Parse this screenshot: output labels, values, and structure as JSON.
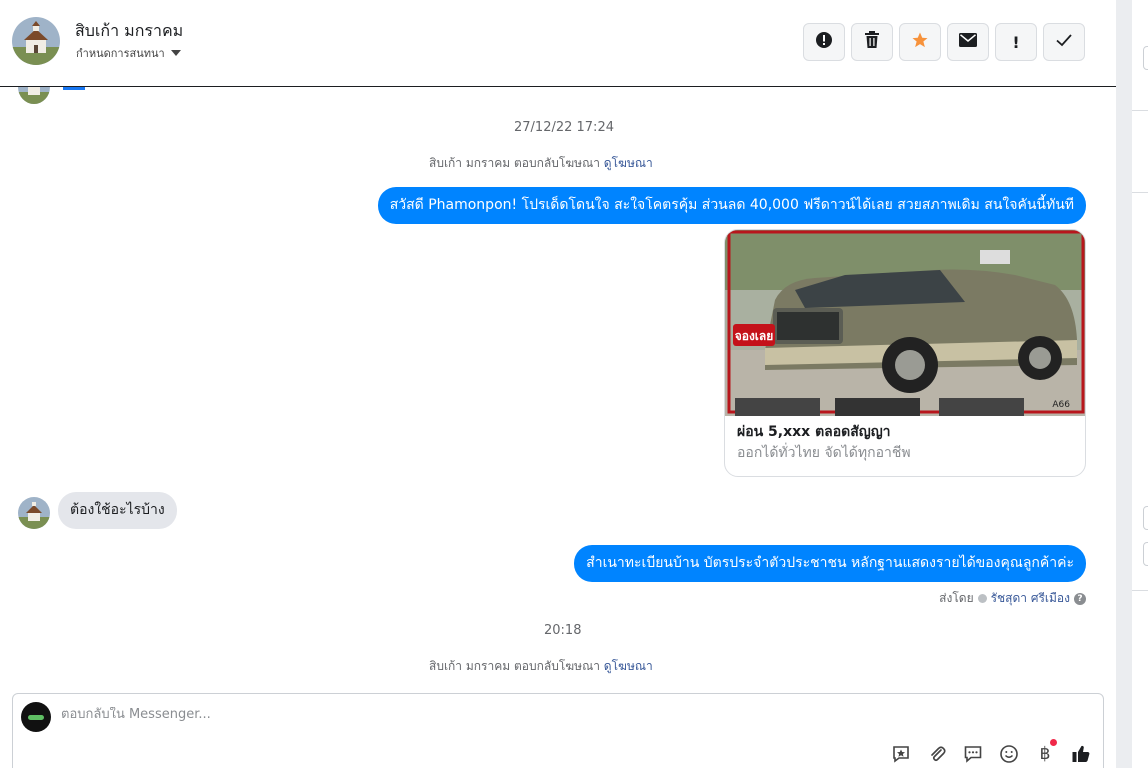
{
  "header": {
    "name": "สิบเก้า มกราคม",
    "assign_label": "กำหนดการสนทนา",
    "actions": [
      {
        "icon": "alert-icon",
        "glyph": "!"
      },
      {
        "icon": "trash-icon",
        "glyph": ""
      },
      {
        "icon": "star-icon",
        "glyph": "★"
      },
      {
        "icon": "mail-icon",
        "glyph": "✉"
      },
      {
        "icon": "exclamation-icon",
        "glyph": "!"
      },
      {
        "icon": "check-icon",
        "glyph": "✓"
      }
    ]
  },
  "messages": {
    "time_1": "27/12/22 17:24",
    "reply_note_1": {
      "text": "สิบเก้า มกราคม ตอบกลับโฆษณา",
      "link": "ดูโฆษณา"
    },
    "out_1": "สวัสดี Phamonpon! โปรเด็ดโดนใจ สะใจโคตรคุ้ม ส่วนลด 40,000 ฟรีดาวน์ได้เลย สวยสภาพเดิม สนใจคันนี้ทันที",
    "card": {
      "image_badge": "จองเลย",
      "image_code": "A66",
      "title": "ผ่อน 5,xxx ตลอดสัญญา",
      "subtitle": "ออกได้ทั่วไทย จัดได้ทุกอาชีพ"
    },
    "in_1": "ต้องใช้อะไรบ้าง",
    "out_2": "สำเนาทะเบียนบ้าน บัตรประจำตัวประชาชน หลักฐานแสดงรายได้ของคุณลูกค้าค่ะ",
    "sent_by": {
      "prefix": "ส่งโดย",
      "name": "รัชสุดา ศรีเมือง"
    },
    "time_2": "20:18",
    "reply_note_2": {
      "text": "สิบเก้า มกราคม ตอบกลับโฆษณา",
      "link": "ดูโฆษณา"
    }
  },
  "composer": {
    "placeholder": "ตอบกลับใน Messenger...",
    "tools": [
      "saved-reply-icon",
      "attachment-icon",
      "chat-bubble-icon",
      "emoji-icon",
      "payment-icon",
      "like-icon"
    ]
  },
  "colors": {
    "accent": "#0084ff",
    "link": "#385898",
    "incoming_bubble": "#e4e6eb",
    "star": "#f7923b"
  }
}
